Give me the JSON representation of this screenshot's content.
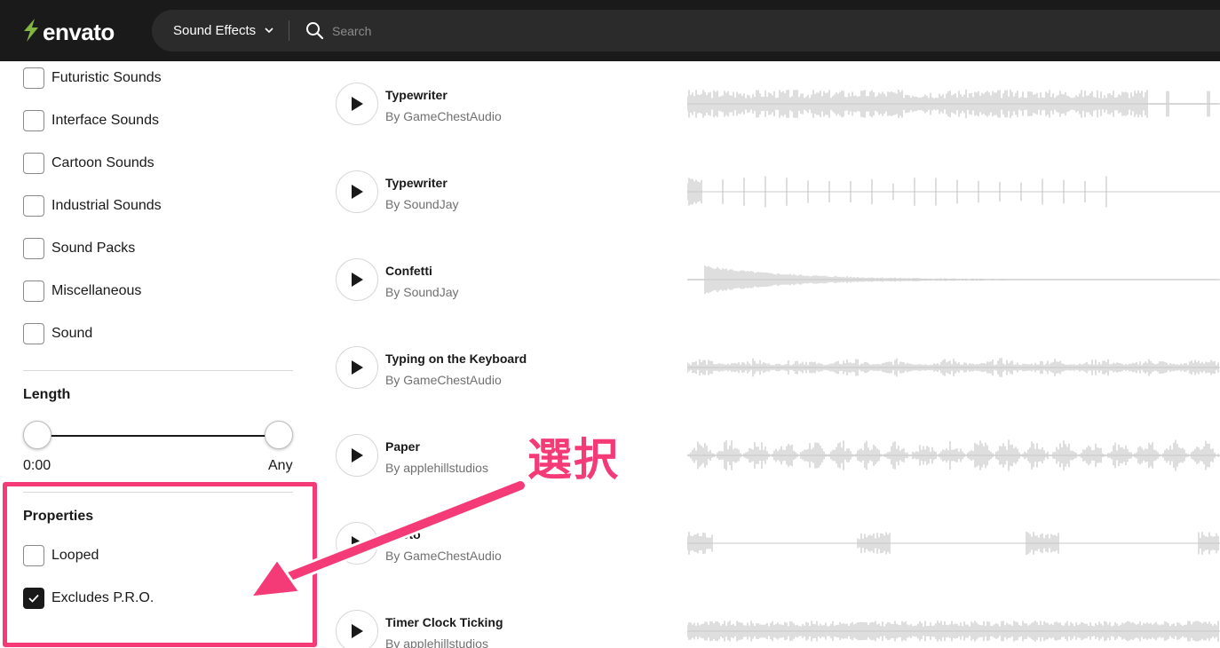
{
  "header": {
    "brand": "envato",
    "category": "Sound Effects",
    "search_placeholder": "Search"
  },
  "sidebar": {
    "categories": [
      {
        "label": "Futuristic Sounds",
        "checked": false
      },
      {
        "label": "Interface Sounds",
        "checked": false
      },
      {
        "label": "Cartoon Sounds",
        "checked": false
      },
      {
        "label": "Industrial Sounds",
        "checked": false
      },
      {
        "label": "Sound Packs",
        "checked": false
      },
      {
        "label": "Miscellaneous",
        "checked": false
      },
      {
        "label": "Sound",
        "checked": false
      }
    ],
    "length": {
      "title": "Length",
      "min_label": "0:00",
      "max_label": "Any"
    },
    "properties": {
      "title": "Properties",
      "items": [
        {
          "label": "Looped",
          "checked": false
        },
        {
          "label": "Excludes P.R.O.",
          "checked": true
        }
      ]
    }
  },
  "tracks": [
    {
      "title": "Typewriter",
      "author": "By GameChestAudio"
    },
    {
      "title": "Typewriter",
      "author": "By SoundJay"
    },
    {
      "title": "Confetti",
      "author": "By SoundJay"
    },
    {
      "title": "Typing on the Keyboard",
      "author": "By GameChestAudio"
    },
    {
      "title": "Paper",
      "author": "By applehillstudios"
    },
    {
      "title": "Photo",
      "author": "By GameChestAudio"
    },
    {
      "title": "Timer Clock Ticking",
      "author": "By applehillstudios"
    }
  ],
  "annotation": {
    "text": "選択",
    "color": "#f53a78"
  },
  "colors": {
    "brand_green": "#82b541",
    "header_bg": "#1a1a1a",
    "waveform": "#c8c8c8"
  }
}
